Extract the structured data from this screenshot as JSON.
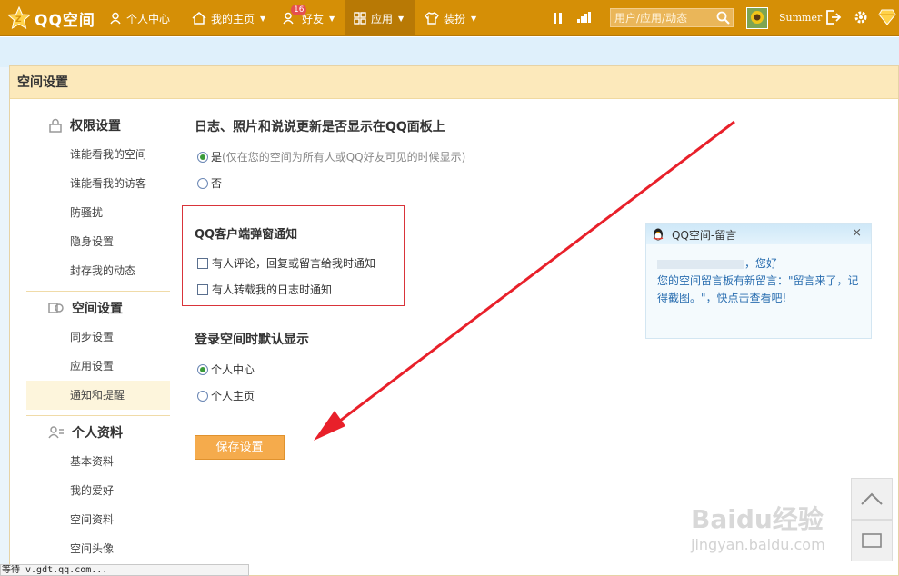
{
  "app": {
    "logo_text": "QQ空间"
  },
  "nav": {
    "items": [
      {
        "label": "个人中心"
      },
      {
        "label": "我的主页"
      },
      {
        "label": "好友",
        "badge": "16"
      },
      {
        "label": "应用"
      },
      {
        "label": "装扮"
      }
    ]
  },
  "search": {
    "placeholder": "用户/应用/动态"
  },
  "user": {
    "name": "Summer"
  },
  "panel": {
    "title": "空间设置"
  },
  "sidebar": {
    "groups": [
      {
        "title": "权限设置",
        "items": [
          "谁能看我的空间",
          "谁能看我的访客",
          "防骚扰",
          "隐身设置",
          "封存我的动态"
        ]
      },
      {
        "title": "空间设置",
        "items": [
          "同步设置",
          "应用设置",
          "通知和提醒"
        ],
        "active": "通知和提醒"
      },
      {
        "title": "个人资料",
        "items": [
          "基本资料",
          "我的爱好",
          "空间资料",
          "空间头像"
        ]
      }
    ]
  },
  "main": {
    "section1": {
      "title": "日志、照片和说说更新是否显示在QQ面板上",
      "opt_yes": "是",
      "opt_yes_hint": "(仅在您的空间为所有人或QQ好友可见的时候显示)",
      "opt_no": "否",
      "selected": "是"
    },
    "section2": {
      "title": "QQ客户端弹窗通知",
      "check1": "有人评论，回复或留言给我时通知",
      "check2": "有人转载我的日志时通知"
    },
    "section3": {
      "title": "登录空间时默认显示",
      "opt1": "个人中心",
      "opt2": "个人主页",
      "selected": "个人中心"
    },
    "save_label": "保存设置"
  },
  "popup": {
    "title": "QQ空间-留言",
    "close": "×",
    "greeting": "，您好",
    "line1": "您的空间留言板有新留言：\"留言来了，记",
    "line2": "得截图。\"，快点击查看吧!"
  },
  "watermark": {
    "brand": "Baidu经验",
    "url": "jingyan.baidu.com"
  },
  "status": {
    "text": "等待 v.gdt.qq.com..."
  },
  "colors": {
    "topbar": "#d58f06",
    "panel_header": "#fce9bb",
    "button": "#f5ab4c",
    "annotation": "#e8202a"
  }
}
